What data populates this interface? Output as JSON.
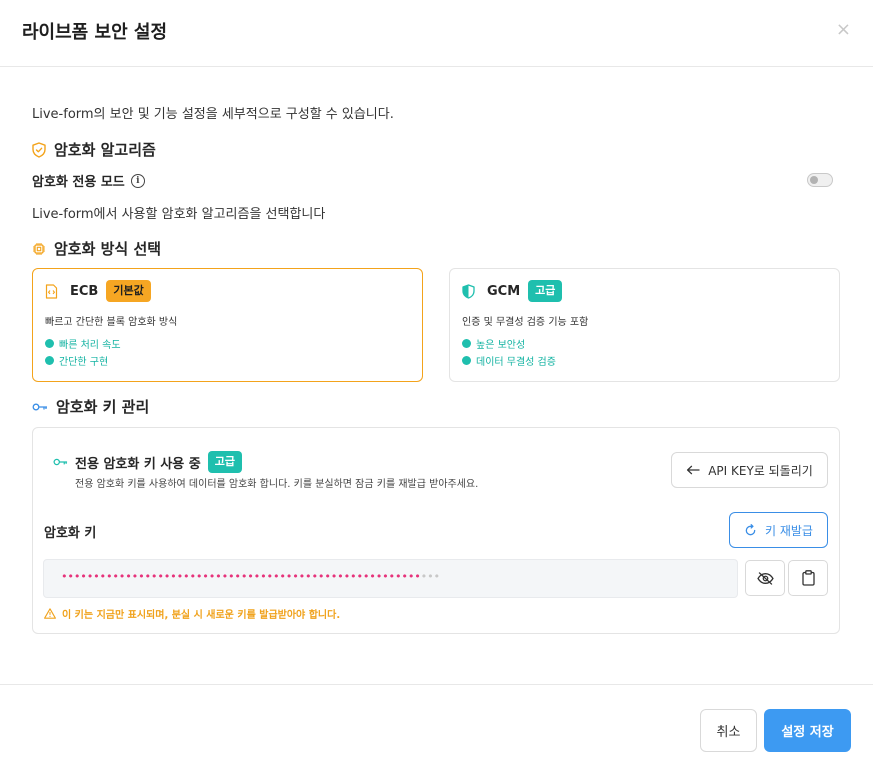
{
  "modal": {
    "title": "라이브폼 보안 설정",
    "close_glyph": "×",
    "description": "Live-form의 보안 및 기능 설정을 세부적으로 구성할 수 있습니다."
  },
  "algorithm_section": {
    "title": "암호화 알고리즘",
    "icon": "shield-check-icon",
    "exclusive_mode_label": "암호화 전용 모드",
    "info_glyph": "i",
    "exclusive_mode_enabled": false,
    "select_description": "Live-form에서 사용할 암호화 알고리즘을 선택합니다"
  },
  "method_section": {
    "title": "암호화 방식 선택",
    "icon": "chip-icon",
    "options": [
      {
        "name": "ECB",
        "badge": "기본값",
        "icon": "code-file-icon",
        "description": "빠르고 간단한 블록 암호화 방식",
        "features": [
          "빠른 처리 속도",
          "간단한 구현"
        ],
        "selected": true
      },
      {
        "name": "GCM",
        "badge": "고급",
        "icon": "shield-half-icon",
        "description": "인증 및 무결성 검증 기능 포함",
        "features": [
          "높은 보안성",
          "데이터 무결성 검증"
        ],
        "selected": false
      }
    ]
  },
  "key_section": {
    "title": "암호화 키 관리",
    "icon": "key-icon",
    "status_title": "전용 암호화 키 사용 중",
    "status_badge": "고급",
    "status_description": "전용 암호화 키를 사용하여 데이터를 암호화 합니다. 키를 분실하면 잠금 키를 재발급 받아주세요.",
    "revert_button": "API KEY로 되돌리기",
    "key_label": "암호화 키",
    "reissue_button": "키 재발급",
    "masked_key": "••••••••••••••••••••••••••••••••••••••••••••••••••••••••",
    "masked_key_tail": "•••",
    "warning": "이 키는 지금만 표시되며, 분실 시 새로운 키를 발급받아야 합니다."
  },
  "footer": {
    "cancel_button": "취소",
    "save_button": "설정 저장"
  },
  "colors": {
    "accent_orange": "#f6a623",
    "accent_teal": "#1fbfae",
    "primary_blue": "#3d9af2",
    "key_text": "#e6337b"
  }
}
